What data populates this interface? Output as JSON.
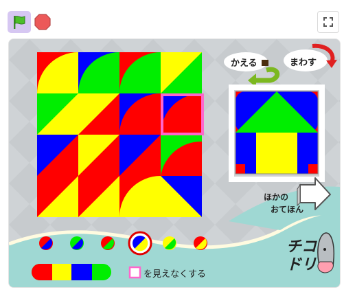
{
  "toolbar": {
    "flag_icon": "green-flag-icon",
    "stop_icon": "stop-sign-icon",
    "fullscreen_icon": "fullscreen-icon"
  },
  "colors": {
    "red": "#ff0000",
    "yellow": "#ffff00",
    "green": "#00ee00",
    "blue": "#0000ff",
    "pink_frame": "#ff66cc",
    "stage_bg": "#cfd3d6",
    "bottom_teal": "#9fd8d3"
  },
  "stage": {
    "flip_label": "かえる",
    "rotate_label": "まわす",
    "other_label_line1": "ほかの",
    "other_label_line2": "おてほん",
    "hide_frame_label": "を見えなくする",
    "brand_line1": "チコ",
    "brand_line2": "ドリ"
  },
  "palette": {
    "selected_index": 3,
    "swatches": [
      {
        "name": "red-blue"
      },
      {
        "name": "green-blue"
      },
      {
        "name": "red-green"
      },
      {
        "name": "yellow-blue"
      },
      {
        "name": "yellow-green"
      },
      {
        "name": "red-yellow"
      }
    ],
    "color_strip": [
      "red",
      "yellow",
      "blue",
      "green"
    ]
  }
}
